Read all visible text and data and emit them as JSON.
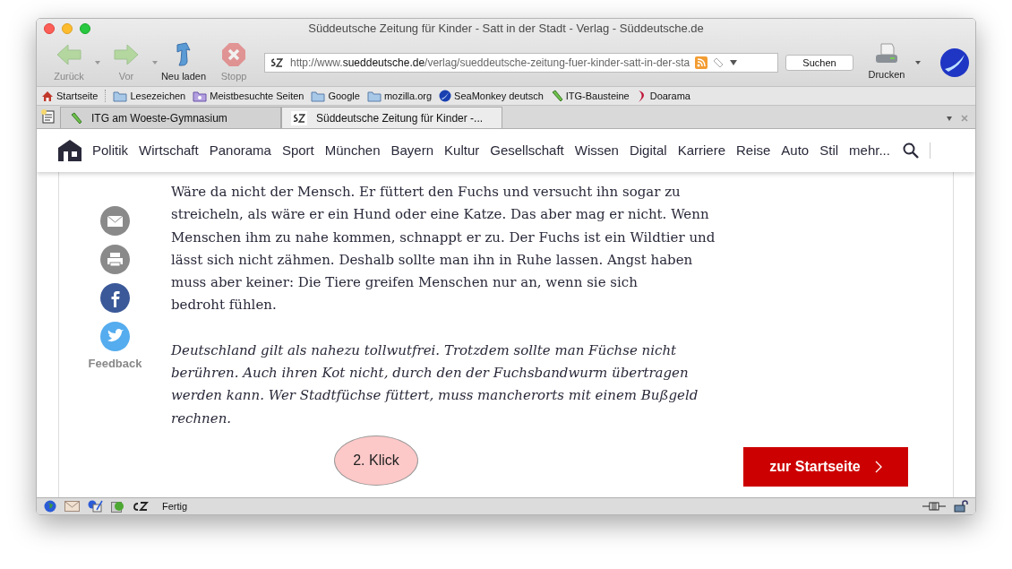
{
  "window": {
    "title": "Süddeutsche Zeitung für Kinder - Satt in der Stadt - Verlag - Süddeutsche.de"
  },
  "toolbar": {
    "buttons": [
      {
        "label": "Zurück",
        "disabled": true,
        "kind": "back"
      },
      {
        "label": "Vor",
        "disabled": true,
        "kind": "forward"
      },
      {
        "label": "Neu laden",
        "disabled": false,
        "kind": "reload"
      },
      {
        "label": "Stopp",
        "disabled": true,
        "kind": "stop"
      }
    ],
    "url": {
      "prefix": "http://www.",
      "domain": "sueddeutsche.de",
      "path": "/verlag/sueddeutsche-zeitung-fuer-kinder-satt-in-der-sta"
    },
    "search_button": "Suchen",
    "print_button": "Drucken"
  },
  "bookmarks": [
    {
      "label": "Startseite",
      "kind": "home"
    },
    {
      "label": "Lesezeichen",
      "kind": "folder"
    },
    {
      "label": "Meistbesuchte Seiten",
      "kind": "smart"
    },
    {
      "label": "Google",
      "kind": "folder"
    },
    {
      "label": "mozilla.org",
      "kind": "folder"
    },
    {
      "label": "SeaMonkey deutsch",
      "kind": "seamonkey"
    },
    {
      "label": "ITG-Bausteine",
      "kind": "pin"
    },
    {
      "label": "Doarama",
      "kind": "doarama"
    }
  ],
  "tabs": [
    {
      "label": "ITG am Woeste-Gymnasium",
      "selected": false,
      "kind": "pin"
    },
    {
      "label": "Süddeutsche Zeitung für Kinder -...",
      "selected": true,
      "kind": "sz"
    }
  ],
  "nav": {
    "items": [
      "Politik",
      "Wirtschaft",
      "Panorama",
      "Sport",
      "München",
      "Bayern",
      "Kultur",
      "Gesellschaft",
      "Wissen",
      "Digital",
      "Karriere",
      "Reise",
      "Auto",
      "Stil",
      "mehr..."
    ]
  },
  "share": {
    "feedback": "Feedback"
  },
  "article": {
    "paragraphs": [
      {
        "kind": "normal",
        "lines": [
          "Wäre da nicht der Mensch. Er füttert den Fuchs und versucht ihn sogar zu",
          "streicheln, als wäre er ein Hund oder eine Katze. Das aber mag er nicht. Wenn",
          "Menschen ihm zu nahe kommen, schnappt er zu. Der Fuchs ist ein Wildtier und",
          "lässt sich nicht zähmen. Deshalb sollte man ihn in Ruhe lassen. Angst haben",
          "muss aber keiner: Die Tiere greifen Menschen nur an, wenn sie sich",
          "bedroht fühlen."
        ]
      },
      {
        "kind": "italic",
        "lines": [
          "Deutschland gilt als nahezu tollwutfrei. Trotzdem sollte man Füchse nicht",
          "berühren. Auch ihren Kot nicht, durch den der Fuchsbandwurm übertragen",
          "werden kann. Wer Stadtfüchse füttert, muss mancherorts mit einem Bußgeld",
          "rechnen."
        ]
      }
    ]
  },
  "annotation": "2. Klick",
  "home_button": "zur Startseite",
  "status_bar": {
    "text": "Fertig"
  }
}
